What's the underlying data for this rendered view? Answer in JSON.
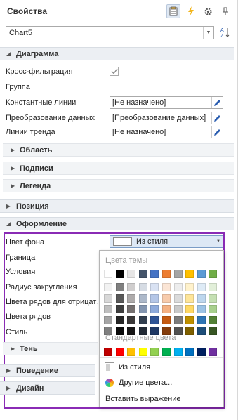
{
  "header": {
    "title": "Свойства",
    "icons": [
      "properties-icon",
      "events-icon",
      "gear-icon",
      "pin-icon"
    ]
  },
  "selector": {
    "value": "Chart5"
  },
  "sections": {
    "diagram": "Диаграмма",
    "position": "Позиция",
    "appearance": "Оформление",
    "behavior": "Поведение",
    "design": "Дизайн"
  },
  "subsections": {
    "area": "Область",
    "labels": "Подписи",
    "legend": "Легенда",
    "shadow": "Тень"
  },
  "diagram_props": {
    "cross_filter": "Кросс-фильтрация",
    "group": "Группа",
    "const_lines": "Константные линии",
    "const_lines_value": "[Не назначено]",
    "data_transform": "Преобразование данных",
    "data_transform_value": "[Преобразование данных]",
    "trend_lines": "Линии тренда",
    "trend_lines_value": "[Не назначено]"
  },
  "appearance_props": {
    "background_color": "Цвет фона",
    "background_color_value": "Из стиля",
    "border": "Граница",
    "conditions": "Условия",
    "corner_radius": "Радиус закругления",
    "negative_series_colors": "Цвета рядов для отрицат…",
    "series_colors": "Цвета рядов",
    "style": "Стиль"
  },
  "palette": {
    "theme_colors_label": "Цвета темы",
    "standard_colors_label": "Стандартные цвета",
    "theme_top": [
      "#ffffff",
      "#000000",
      "#e7e6e6",
      "#44546a",
      "#4472c4",
      "#ed7d31",
      "#a5a5a5",
      "#ffc000",
      "#5b9bd5",
      "#70ad47"
    ],
    "theme_shades": [
      [
        "#f2f2f2",
        "#808080",
        "#d0cece",
        "#d6dce4",
        "#d9e2f3",
        "#fbe5d5",
        "#ededed",
        "#fff2cc",
        "#deebf6",
        "#e2efd9"
      ],
      [
        "#d8d8d8",
        "#595959",
        "#aeabab",
        "#adb9ca",
        "#b4c6e7",
        "#f7cbac",
        "#dbdbdb",
        "#fee599",
        "#bdd7ee",
        "#c5e0b3"
      ],
      [
        "#bfbfbf",
        "#3f3f3f",
        "#757070",
        "#8496b0",
        "#8eaadb",
        "#f4b183",
        "#c9c9c9",
        "#ffd965",
        "#9cc3e5",
        "#a8d08d"
      ],
      [
        "#a5a5a5",
        "#262626",
        "#3a3838",
        "#323f4f",
        "#2f5496",
        "#c55a11",
        "#7b7b7b",
        "#bf9000",
        "#2e75b5",
        "#538135"
      ],
      [
        "#7f7f7f",
        "#0c0c0c",
        "#171616",
        "#222a35",
        "#1f3864",
        "#843c0b",
        "#525252",
        "#7f6000",
        "#1e4e79",
        "#375623"
      ]
    ],
    "standard": [
      "#c00000",
      "#ff0000",
      "#ffc000",
      "#ffff00",
      "#92d050",
      "#00b050",
      "#00b0f0",
      "#0070c0",
      "#002060",
      "#7030a0"
    ],
    "from_style": "Из стиля",
    "more_colors": "Другие цвета...",
    "insert_expression": "Вставить выражение"
  }
}
